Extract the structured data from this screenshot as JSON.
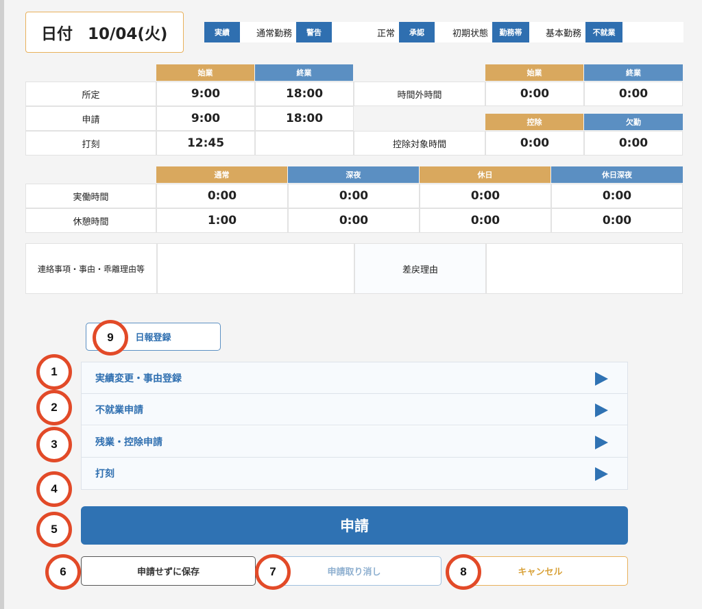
{
  "date": {
    "label": "日付",
    "value": "10/04(火)"
  },
  "status_bar": [
    {
      "kind": "tag",
      "text": "実績"
    },
    {
      "kind": "txt",
      "text": "通常勤務"
    },
    {
      "kind": "tag",
      "text": "警告"
    },
    {
      "kind": "txt",
      "text": "正常"
    },
    {
      "kind": "tag",
      "text": "承認"
    },
    {
      "kind": "txt",
      "text": "初期状態"
    },
    {
      "kind": "tag",
      "text": "勤務帯"
    },
    {
      "kind": "txt",
      "text": "基本勤務"
    },
    {
      "kind": "tag",
      "text": "不就業"
    }
  ],
  "schedule": {
    "headers": {
      "start": "始業",
      "end": "終業"
    },
    "rows": {
      "scheduled": {
        "label": "所定",
        "start": "9:00",
        "end": "18:00"
      },
      "requested": {
        "label": "申請",
        "start": "9:00",
        "end": "18:00"
      },
      "stamped": {
        "label": "打刻",
        "start": "12:45",
        "end": ""
      }
    }
  },
  "overtime": {
    "headers": {
      "start": "始業",
      "end": "終業"
    },
    "label": "時間外時間",
    "start": "0:00",
    "end": "0:00"
  },
  "deduction": {
    "headers": {
      "deduct": "控除",
      "absence": "欠勤"
    },
    "label": "控除対象時間",
    "deduct": "0:00",
    "absence": "0:00"
  },
  "hours": {
    "headers": {
      "normal": "通常",
      "night": "深夜",
      "holiday": "休日",
      "holiday_night": "休日深夜"
    },
    "actual": {
      "label": "実働時間",
      "normal": "0:00",
      "night": "0:00",
      "holiday": "0:00",
      "holiday_night": "0:00"
    },
    "break": {
      "label": "休憩時間",
      "normal": "1:00",
      "night": "0:00",
      "holiday": "0:00",
      "holiday_night": "0:00"
    }
  },
  "notes": {
    "contact_label": "連絡事項・事由・乖離理由等",
    "contact_value": "",
    "return_label": "差戻理由",
    "return_value": ""
  },
  "daily_report_button": "日報登録",
  "accordion": [
    "実績変更・事由登録",
    "不就業申請",
    "残業・控除申請",
    "打刻"
  ],
  "buttons": {
    "apply": "申請",
    "save_without_apply": "申請せずに保存",
    "withdraw": "申請取り消し",
    "cancel": "キャンセル"
  },
  "markers": [
    "1",
    "2",
    "3",
    "4",
    "5",
    "6",
    "7",
    "8",
    "9"
  ]
}
